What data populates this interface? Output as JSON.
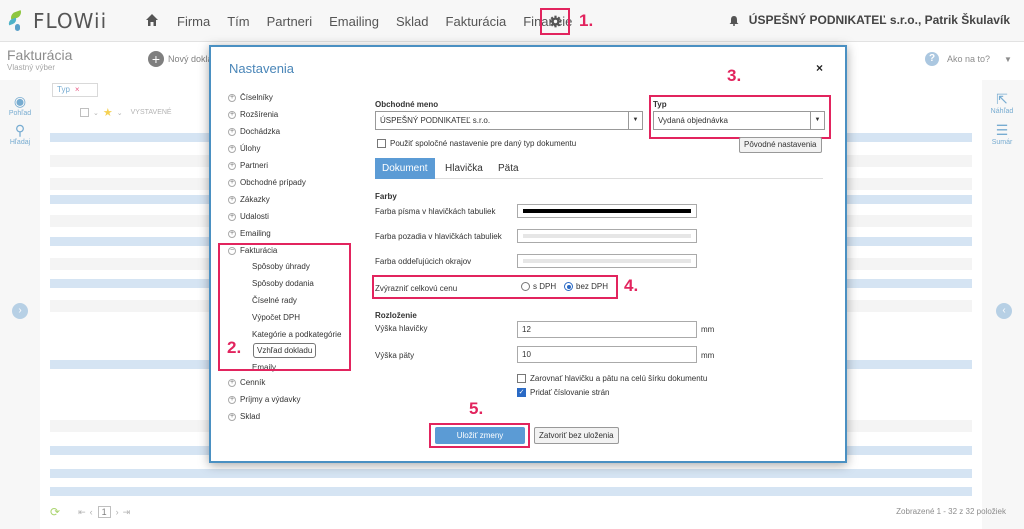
{
  "app": {
    "logo_text": "FLOWii"
  },
  "nav": {
    "items": [
      "Firma",
      "Tím",
      "Partneri",
      "Emailing",
      "Sklad",
      "Fakturácia",
      "Financie"
    ],
    "user": "ÚSPEŠNÝ PODNIKATEĽ s.r.o., Patrik Škulavík"
  },
  "annotations": {
    "a1": "1.",
    "a2": "2.",
    "a3": "3.",
    "a4": "4.",
    "a5": "5."
  },
  "page": {
    "title": "Fakturácia",
    "subtitle": "Vlastný výber",
    "new_doc": "Nový doklad",
    "help": "Ako na to?",
    "left_side": {
      "view": "Pohľad",
      "search": "Hľadaj"
    },
    "right_side": {
      "preview": "Náhľad",
      "summary": "Sumár"
    },
    "filter_tag": "Typ",
    "col_issued": "VYSTAVENÉ",
    "pager_page": "1",
    "count_info": "Zobrazené 1 - 32 z 32 položiek"
  },
  "modal": {
    "title": "Nastavenia",
    "close": "×",
    "tree": {
      "top_cut": "Číselníky",
      "items_before": [
        "Číselníky",
        "Rozšírenia",
        "Dochádzka",
        "Úlohy",
        "Partneri",
        "Obchodné prípady",
        "Zákazky",
        "Udalosti",
        "Emailing"
      ],
      "expanded": "Fakturácia",
      "sub_items": [
        "Spôsoby úhrady",
        "Spôsoby dodania",
        "Číselné rady",
        "Výpočet DPH",
        "Kategórie a podkategórie",
        "Vzhľad dokladu",
        "Emaily"
      ],
      "items_after": [
        "Cenník",
        "Príjmy a výdavky",
        "Sklad"
      ]
    },
    "form": {
      "company_label": "Obchodné meno",
      "company_value": "ÚSPEŠNÝ PODNIKATEĽ s.r.o.",
      "type_label": "Typ",
      "type_value": "Vydaná objednávka",
      "use_common": "Použiť spoločné nastavenie pre daný typ dokumentu",
      "original_settings": "Pôvodné nastavenia",
      "tabs": [
        "Dokument",
        "Hlavička",
        "Päta"
      ],
      "colors_heading": "Farby",
      "color_font_label": "Farba písma v hlavičkách tabuliek",
      "color_bg_label": "Farba pozadia v hlavičkách tabuliek",
      "color_border_label": "Farba oddeľujúcich okrajov",
      "colors": {
        "font": "#000000",
        "background": "#e6e6e6",
        "border": "#e6e6e6"
      },
      "highlight_label": "Zvýrazniť celkovú cenu",
      "radio_with_vat": "s DPH",
      "radio_without_vat": "bez DPH",
      "layout_heading": "Rozloženie",
      "header_height_label": "Výška hlavičky",
      "header_height_value": "12",
      "footer_height_label": "Výška päty",
      "footer_height_value": "10",
      "unit": "mm",
      "align_full_width": "Zarovnať hlavičku a pätu na celú šírku dokumentu",
      "add_page_numbers": "Pridať číslovanie strán",
      "save_button": "Uložiť zmeny",
      "close_button": "Zatvoriť bez uloženia"
    }
  }
}
